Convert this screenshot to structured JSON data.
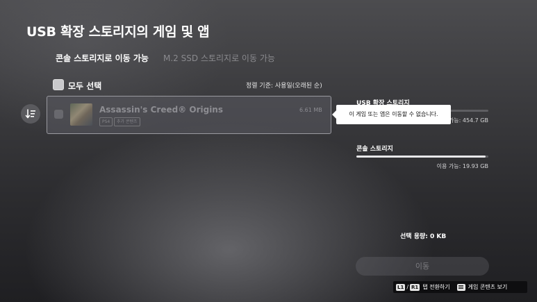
{
  "page": {
    "title": "USB 확장 스토리지의 게임 및 앱"
  },
  "tabs": [
    {
      "label": "콘솔 스토리지로 이동 가능",
      "active": true
    },
    {
      "label": "M.2 SSD 스토리지로 이동 가능",
      "active": false
    }
  ],
  "list": {
    "select_all_label": "모두 선택",
    "sort_label": "정렬 기준: 사용일(오래된 순)",
    "sort_icon": "sort-icon",
    "items": [
      {
        "title": "Assassin's Creed® Origins",
        "badges": [
          "PS4",
          "추가 콘텐츠"
        ],
        "size": "6.61 MB",
        "checked": false,
        "disabled": true
      }
    ]
  },
  "tooltip": {
    "text": "이 게임 또는 앱은 이동할 수 없습니다."
  },
  "storage": [
    {
      "label": "USB 확장 스토리지",
      "available_text": "이용 가능: 454.7 GB",
      "used_fraction": 0.02
    },
    {
      "label": "콘솔 스토리지",
      "available_text": "이용 가능: 19.93 GB",
      "used_fraction": 0.98
    }
  ],
  "selection": {
    "capacity_text": "선택 용량: 0 KB"
  },
  "move_button": {
    "label": "이동",
    "enabled": false
  },
  "hints": {
    "l1_key": "L1",
    "r1_key": "R1",
    "separator": "/",
    "tab_switch_label": "탭 전환하기",
    "menu_icon": "options-icon",
    "view_content_label": "게임 콘텐츠 보기"
  },
  "colors": {
    "background": "#3a3a3d",
    "accent": "#ffffff",
    "disabled_text": "#8d8d92"
  }
}
